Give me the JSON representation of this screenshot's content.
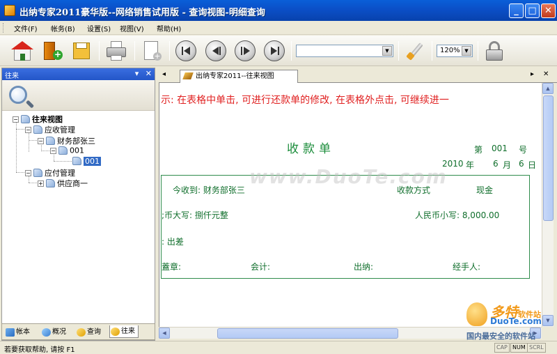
{
  "window": {
    "title": "出纳专家2011豪华版--网络销售试用版 - 查询视图-明细查询",
    "controls": {
      "minimize": "_",
      "maximize": "□",
      "close": "✕"
    }
  },
  "menu": [
    "文件(F)",
    "帐务(B)",
    "设置(S)",
    "视图(V)",
    "帮助(H)"
  ],
  "toolbar": {
    "buttons": [
      "home-icon",
      "add-book-icon",
      "save-icon",
      "print-icon",
      "new-document-icon",
      "first-record-icon",
      "previous-record-icon",
      "next-record-icon",
      "last-record-icon",
      "tools-icon",
      "lock-icon"
    ],
    "combo_value": "",
    "zoom": "120%"
  },
  "left_panel": {
    "title": "往来",
    "tree": {
      "root": "往来视图",
      "receivable": "应收管理",
      "finance_zhang": "财务部张三",
      "code_parent": "001",
      "code_child": "001",
      "payable": "应付管理",
      "supplier": "供应商一"
    },
    "tabs": [
      "帐本",
      "概况",
      "查询",
      "往来"
    ],
    "active_tab": "往来"
  },
  "document": {
    "tab_label": "出纳专家2011--往来视图",
    "hint": "示: 在表格中单击, 可进行还款单的修改, 在表格外点击, 可继续进一",
    "title": "收款单",
    "number_prefix": "第",
    "number": "001",
    "number_suffix": "号",
    "date_year": "2010",
    "date_year_label": "年",
    "date_month": "6",
    "date_month_label": "月",
    "date_day": "6",
    "date_day_label": "日",
    "received_from": "今收到: 财务部张三",
    "payment_method_label": "收款方式",
    "payment_method": "现金",
    "amount_upper": ";币大写: 捌仟元整",
    "amount_lower": "人民币小写: 8,000.00",
    "reason": ": 出差",
    "seal": "蓋章:",
    "accountant": "会计:",
    "cashier": "出纳:",
    "handler": "经手人:"
  },
  "statusbar": {
    "message": "若要获取帮助, 请按 F1",
    "indicators": [
      "CAP",
      "NUM",
      "SCRL"
    ]
  },
  "watermark": "www.DuoTe.com",
  "brand": {
    "name": "多特",
    "sub": "软件站",
    "site": "DuoTe.com",
    "slogan": "国内最安全的软件站"
  }
}
